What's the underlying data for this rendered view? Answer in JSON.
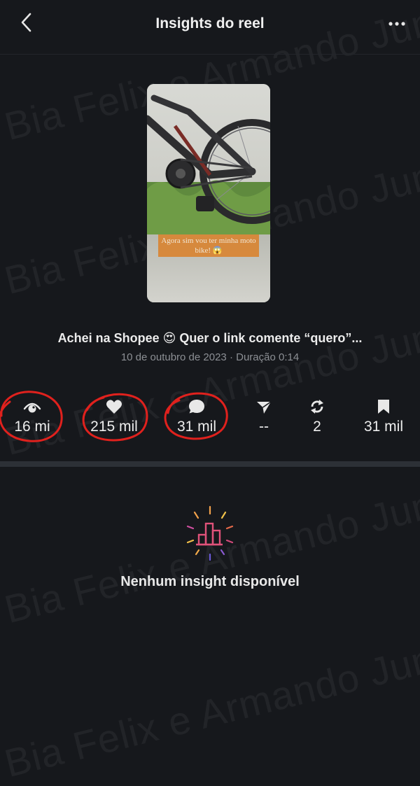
{
  "header": {
    "title": "Insights do reel",
    "back_icon": "chevron-left-icon",
    "more_icon": "more-horizontal-icon"
  },
  "reel": {
    "caption_overlay": "Agora sim vou ter minha moto bike! 😱",
    "title": "Achei na Shopee 😍 Quer o link comente “quero”...",
    "meta": "10 de outubro de 2023 · Duração 0:14"
  },
  "stats": [
    {
      "icon": "eye-icon",
      "value": "16 mi",
      "circled": true
    },
    {
      "icon": "heart-icon",
      "value": "215 mil",
      "circled": true
    },
    {
      "icon": "comment-icon",
      "value": "31 mil",
      "circled": true
    },
    {
      "icon": "send-icon",
      "value": "--",
      "circled": false
    },
    {
      "icon": "repost-icon",
      "value": "2",
      "circled": false
    },
    {
      "icon": "bookmark-icon",
      "value": "31 mil",
      "circled": false
    }
  ],
  "empty_state": {
    "icon": "insights-chart-icon",
    "text": "Nenhum insight disponível"
  },
  "watermark": {
    "text": "Bia Felix e Armando Junior"
  },
  "colors": {
    "background": "#16181c",
    "circle_mark": "#e0211d",
    "divider": "#2c3036"
  }
}
